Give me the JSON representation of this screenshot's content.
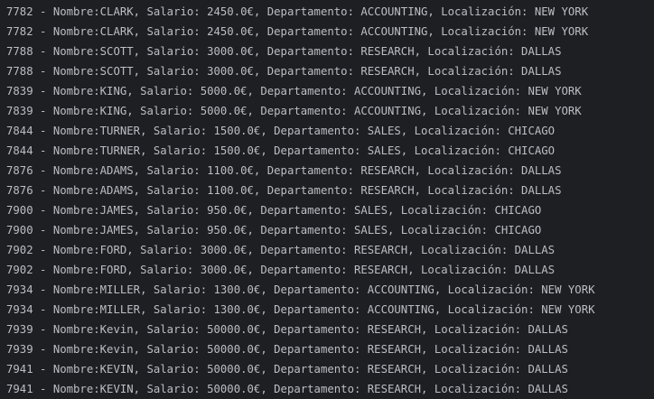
{
  "console": {
    "lines": [
      "7782 - Nombre:CLARK, Salario: 2450.0€, Departamento: ACCOUNTING, Localización: NEW YORK",
      "7782 - Nombre:CLARK, Salario: 2450.0€, Departamento: ACCOUNTING, Localización: NEW YORK",
      "7788 - Nombre:SCOTT, Salario: 3000.0€, Departamento: RESEARCH, Localización: DALLAS",
      "7788 - Nombre:SCOTT, Salario: 3000.0€, Departamento: RESEARCH, Localización: DALLAS",
      "7839 - Nombre:KING, Salario: 5000.0€, Departamento: ACCOUNTING, Localización: NEW YORK",
      "7839 - Nombre:KING, Salario: 5000.0€, Departamento: ACCOUNTING, Localización: NEW YORK",
      "7844 - Nombre:TURNER, Salario: 1500.0€, Departamento: SALES, Localización: CHICAGO",
      "7844 - Nombre:TURNER, Salario: 1500.0€, Departamento: SALES, Localización: CHICAGO",
      "7876 - Nombre:ADAMS, Salario: 1100.0€, Departamento: RESEARCH, Localización: DALLAS",
      "7876 - Nombre:ADAMS, Salario: 1100.0€, Departamento: RESEARCH, Localización: DALLAS",
      "7900 - Nombre:JAMES, Salario: 950.0€, Departamento: SALES, Localización: CHICAGO",
      "7900 - Nombre:JAMES, Salario: 950.0€, Departamento: SALES, Localización: CHICAGO",
      "7902 - Nombre:FORD, Salario: 3000.0€, Departamento: RESEARCH, Localización: DALLAS",
      "7902 - Nombre:FORD, Salario: 3000.0€, Departamento: RESEARCH, Localización: DALLAS",
      "7934 - Nombre:MILLER, Salario: 1300.0€, Departamento: ACCOUNTING, Localización: NEW YORK",
      "7934 - Nombre:MILLER, Salario: 1300.0€, Departamento: ACCOUNTING, Localización: NEW YORK",
      "7939 - Nombre:Kevin, Salario: 50000.0€, Departamento: RESEARCH, Localización: DALLAS",
      "7939 - Nombre:Kevin, Salario: 50000.0€, Departamento: RESEARCH, Localización: DALLAS",
      "7941 - Nombre:KEVIN, Salario: 50000.0€, Departamento: RESEARCH, Localización: DALLAS",
      "7941 - Nombre:KEVIN, Salario: 50000.0€, Departamento: RESEARCH, Localización: DALLAS"
    ]
  },
  "colors": {
    "background": "#1e1f22",
    "text": "#bcbec4"
  }
}
